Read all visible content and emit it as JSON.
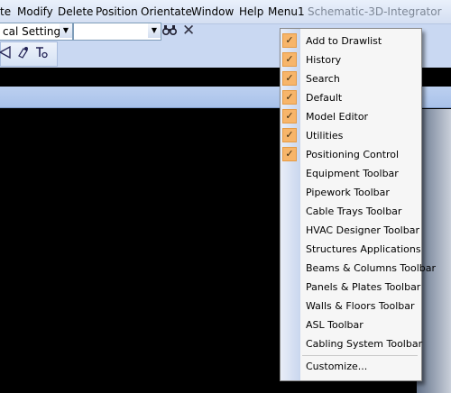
{
  "menubar": {
    "items": [
      {
        "label": "te",
        "key": "file"
      },
      {
        "label": "Modify",
        "key": "modify"
      },
      {
        "label": "Delete",
        "key": "delete"
      },
      {
        "label": "Position",
        "key": "position"
      },
      {
        "label": "Orientate",
        "key": "orientate"
      },
      {
        "label": "Window",
        "key": "window"
      },
      {
        "label": "Help",
        "key": "help"
      },
      {
        "label": "Menu1",
        "key": "menu1"
      }
    ],
    "app_label": "Schematic-3D-Integrator"
  },
  "toolbar": {
    "settings_combo_value": "cal Settings",
    "wide_combo_value": "",
    "icons": [
      "dropdown-arrow-icon",
      "dropdown-arrow-icon",
      "binoculars-icon",
      "close-icon",
      "shape-icon",
      "tool-icon",
      "text-tool-icon"
    ]
  },
  "dropdown": {
    "items": [
      {
        "label": "Add to Drawlist",
        "checked": true
      },
      {
        "label": "History",
        "checked": true
      },
      {
        "label": "Search",
        "checked": true
      },
      {
        "label": "Default",
        "checked": true
      },
      {
        "label": "Model Editor",
        "checked": true
      },
      {
        "label": "Utilities",
        "checked": true
      },
      {
        "label": "Positioning Control",
        "checked": true
      },
      {
        "label": "Equipment Toolbar",
        "checked": false
      },
      {
        "label": "Pipework Toolbar",
        "checked": false
      },
      {
        "label": "Cable Trays Toolbar",
        "checked": false
      },
      {
        "label": "HVAC Designer Toolbar",
        "checked": false
      },
      {
        "label": "Structures Applications",
        "checked": false
      },
      {
        "label": "Beams & Columns Toolbar",
        "checked": false
      },
      {
        "label": "Panels & Plates Toolbar",
        "checked": false
      },
      {
        "label": "Walls & Floors Toolbar",
        "checked": false
      },
      {
        "label": "ASL Toolbar",
        "checked": false
      },
      {
        "label": "Cabling System Toolbar",
        "checked": false
      }
    ],
    "customize_label": "Customize..."
  },
  "colors": {
    "checked_background": "#f7b56a",
    "menubar_background": "#dbe5f5",
    "canvas_background": "#000000"
  }
}
